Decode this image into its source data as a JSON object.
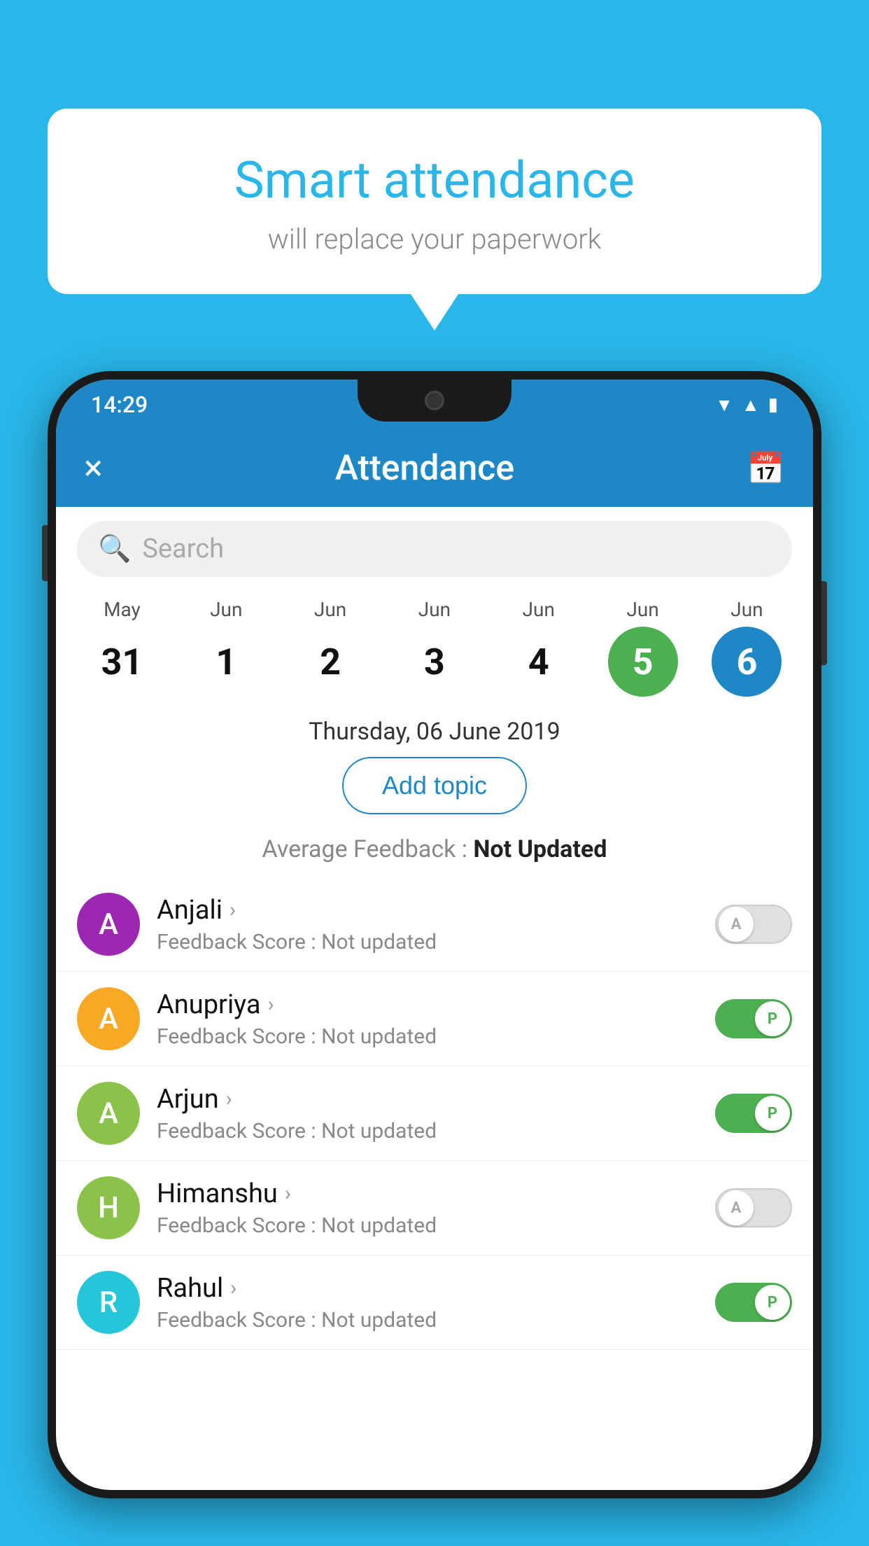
{
  "background_color": "#29b6e8",
  "speech_bubble": {
    "title": "Smart attendance",
    "subtitle": "will replace your paperwork"
  },
  "status_bar": {
    "time": "14:29",
    "icons": [
      "wifi",
      "signal",
      "battery"
    ]
  },
  "app_bar": {
    "title": "Attendance",
    "close_icon": "×",
    "calendar_icon": "📅"
  },
  "search": {
    "placeholder": "Search"
  },
  "calendar": {
    "days": [
      {
        "month": "May",
        "number": "31",
        "state": "normal"
      },
      {
        "month": "Jun",
        "number": "1",
        "state": "normal"
      },
      {
        "month": "Jun",
        "number": "2",
        "state": "normal"
      },
      {
        "month": "Jun",
        "number": "3",
        "state": "normal"
      },
      {
        "month": "Jun",
        "number": "4",
        "state": "normal"
      },
      {
        "month": "Jun",
        "number": "5",
        "state": "today"
      },
      {
        "month": "Jun",
        "number": "6",
        "state": "selected"
      }
    ],
    "selected_date": "Thursday, 06 June 2019"
  },
  "add_topic_button": "Add topic",
  "average_feedback": {
    "label": "Average Feedback : ",
    "value": "Not Updated"
  },
  "students": [
    {
      "name": "Anjali",
      "feedback_label": "Feedback Score : ",
      "feedback_value": "Not updated",
      "avatar_letter": "A",
      "avatar_color": "#9c27b0",
      "toggle_state": "off",
      "toggle_label": "A"
    },
    {
      "name": "Anupriya",
      "feedback_label": "Feedback Score : ",
      "feedback_value": "Not updated",
      "avatar_letter": "A",
      "avatar_color": "#f9a825",
      "toggle_state": "on",
      "toggle_label": "P"
    },
    {
      "name": "Arjun",
      "feedback_label": "Feedback Score : ",
      "feedback_value": "Not updated",
      "avatar_letter": "A",
      "avatar_color": "#8bc34a",
      "toggle_state": "on",
      "toggle_label": "P"
    },
    {
      "name": "Himanshu",
      "feedback_label": "Feedback Score : ",
      "feedback_value": "Not updated",
      "avatar_letter": "H",
      "avatar_color": "#8bc34a",
      "toggle_state": "off",
      "toggle_label": "A"
    },
    {
      "name": "Rahul",
      "feedback_label": "Feedback Score : ",
      "feedback_value": "Not updated",
      "avatar_letter": "R",
      "avatar_color": "#26c6da",
      "toggle_state": "on",
      "toggle_label": "P"
    }
  ]
}
